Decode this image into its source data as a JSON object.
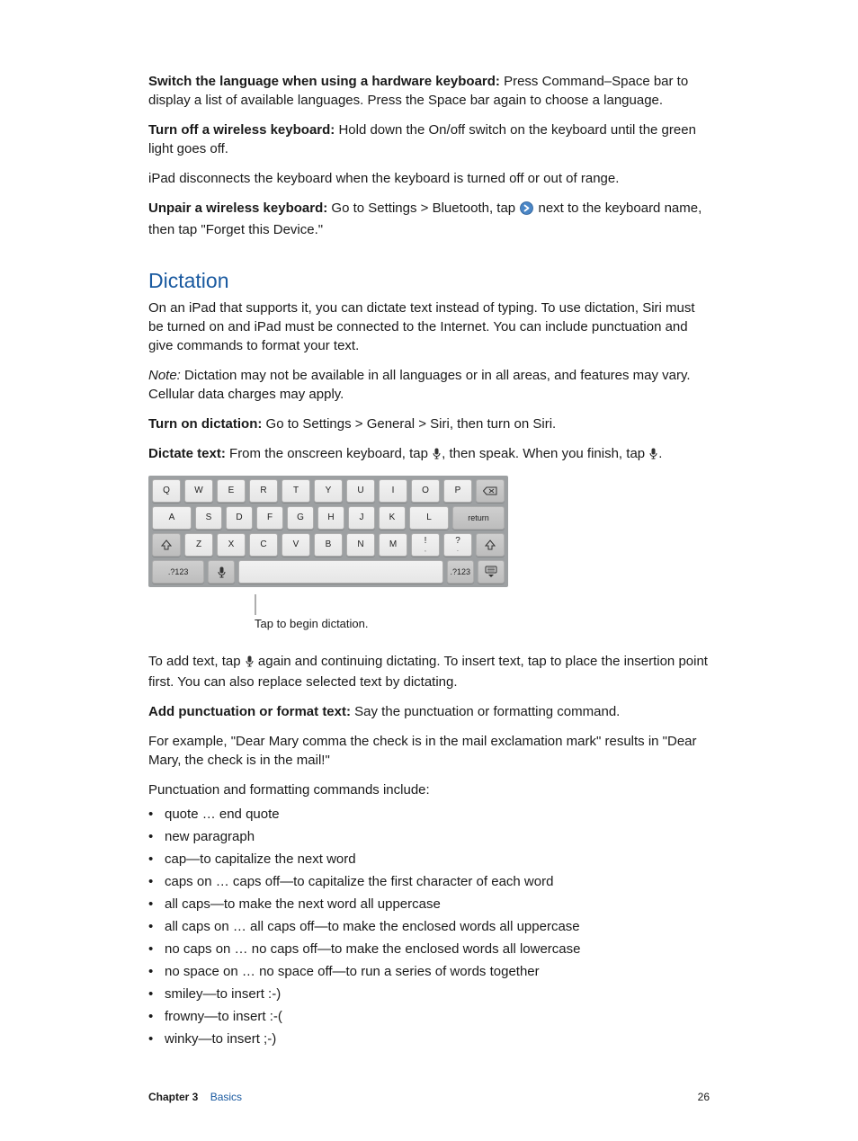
{
  "paragraphs": {
    "switch_lang_label": "Switch the language when using a hardware keyboard:",
    "switch_lang_body": "  Press Command–Space bar to display a list of available languages. Press the Space bar again to choose a language.",
    "turn_off_label": "Turn off a wireless keyboard:",
    "turn_off_body": "  Hold down the On/off switch on the keyboard until the green light goes off.",
    "disconnect": "iPad disconnects the keyboard when the keyboard is turned off or out of range.",
    "unpair_label": "Unpair a wireless keyboard:",
    "unpair_body1": "  Go to Settings > Bluetooth, tap ",
    "unpair_body2": " next to the keyboard name, then tap \"Forget this Device.\""
  },
  "section_heading": "Dictation",
  "dictation": {
    "intro": "On an iPad that supports it, you can dictate text instead of typing. To use dictation, Siri must be turned on and iPad must be connected to the Internet. You can include punctuation and give commands to format your text.",
    "note_label": "Note:",
    "note_body": "  Dictation may not be available in all languages or in all areas, and features may vary. Cellular data charges may apply.",
    "turn_on_label": "Turn on dictation:",
    "turn_on_body": "  Go to Settings > General > Siri, then turn on Siri.",
    "dictate_label": "Dictate text:",
    "dictate_body1": "  From the onscreen keyboard, tap ",
    "dictate_body2": ", then speak. When you finish, tap ",
    "dictate_body3": "."
  },
  "keyboard": {
    "row1": [
      "Q",
      "W",
      "E",
      "R",
      "T",
      "Y",
      "U",
      "I",
      "O",
      "P"
    ],
    "row2": [
      "A",
      "S",
      "D",
      "F",
      "G",
      "H",
      "J",
      "K",
      "L"
    ],
    "row3": [
      "Z",
      "X",
      "C",
      "V",
      "B",
      "N",
      "M"
    ],
    "punct1": "!",
    "punct1_sub": ",",
    "punct2": "?",
    "punct2_sub": ".",
    "return": "return",
    "numkey": ".?123"
  },
  "callout": "Tap to begin dictation.",
  "after_kbd": {
    "add_text_1": "To add text, tap ",
    "add_text_2": " again and continuing dictating. To insert text, tap to place the insertion point first. You can also replace selected text by dictating.",
    "add_punct_label": "Add punctuation or format text:",
    "add_punct_body": "  Say the punctuation or formatting command.",
    "example": "For example, \"Dear Mary comma the check is in the mail exclamation mark\" results in \"Dear Mary, the check is in the mail!\"",
    "commands_intro": "Punctuation and formatting commands include:"
  },
  "commands": [
    "quote … end quote",
    "new paragraph",
    "cap—to capitalize the next word",
    "caps on … caps off—to capitalize the first character of each word",
    "all caps—to make the next word all uppercase",
    "all caps on … all caps off—to make the enclosed words all uppercase",
    "no caps on … no caps off—to make the enclosed words all lowercase",
    "no space on … no space off—to run a series of words together",
    "smiley—to insert :-)",
    "frowny—to insert :-(",
    "winky—to insert ;-)"
  ],
  "footer": {
    "chapter": "Chapter  3",
    "chapter_name": "Basics",
    "page": "26"
  }
}
